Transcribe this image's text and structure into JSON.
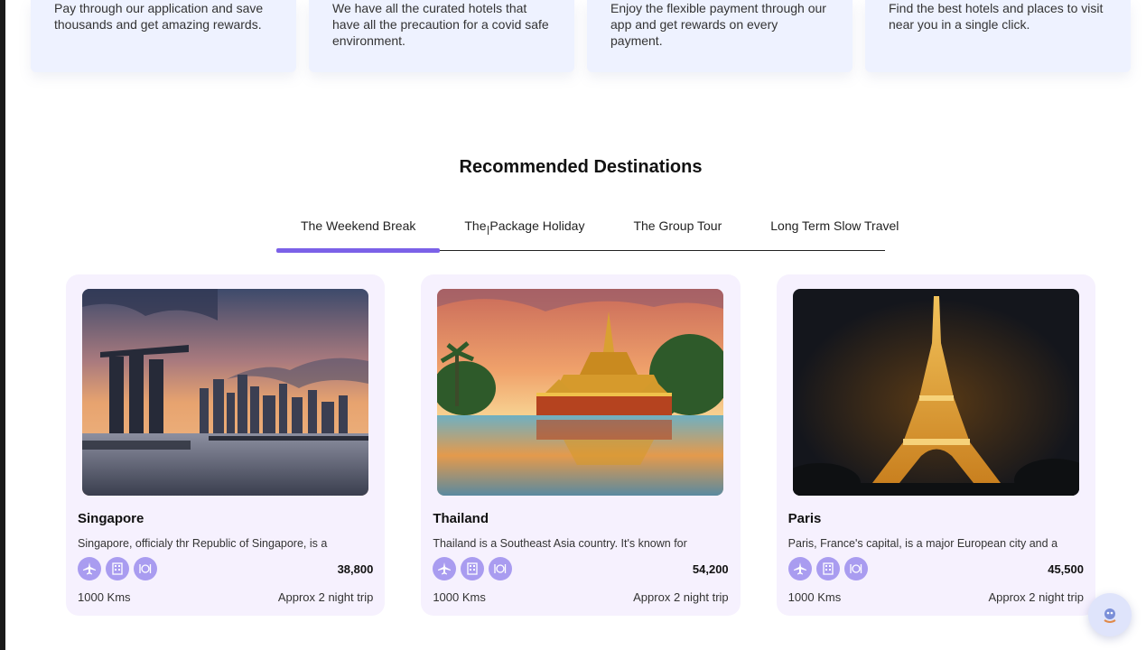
{
  "features": [
    {
      "text": "Pay through our application and save thousands and get amazing rewards."
    },
    {
      "text": "We have all the curated hotels that have all the precaution for a covid safe environment."
    },
    {
      "text": "Enjoy the flexible payment through our app and get rewards on every payment."
    },
    {
      "text": "Find the best hotels and places to visit near you in a single click."
    }
  ],
  "section_title": "Recommended Destinations",
  "tabs": [
    {
      "label": "The Weekend Break"
    },
    {
      "label": "The Package Holiday"
    },
    {
      "label": "The Group Tour"
    },
    {
      "label": "Long Term Slow Travel"
    }
  ],
  "active_tab": "The Weekend Break",
  "accent_color": "#7b61e8",
  "destinations": [
    {
      "name": "Singapore",
      "description": "Singapore, officialy thr Republic of Singapore, is a",
      "price": "38,800",
      "distance": "1000 Kms",
      "trip": "Approx 2 night trip"
    },
    {
      "name": "Thailand",
      "description": "Thailand is a Southeast Asia country. It's known for",
      "price": "54,200",
      "distance": "1000 Kms",
      "trip": "Approx 2 night trip"
    },
    {
      "name": "Paris",
      "description": "Paris, France's capital, is a major European city and a",
      "price": "45,500",
      "distance": "1000 Kms",
      "trip": "Approx 2 night trip"
    }
  ],
  "icons": [
    "airplane-icon",
    "hotel-icon",
    "food-icon"
  ]
}
